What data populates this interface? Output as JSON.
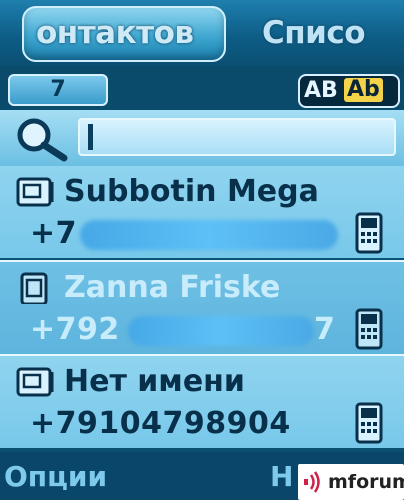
{
  "tabs": {
    "active": "онтактов",
    "other": "Списо"
  },
  "info": {
    "count": "7",
    "mode_ab": "AB",
    "mode_Ab": "Ab"
  },
  "search": {
    "value": ""
  },
  "contacts": [
    {
      "name": "Subbotin Mega",
      "number": "+7",
      "selected": false
    },
    {
      "name": "Zanna Friske",
      "number": "+792",
      "number_tail": "7",
      "selected": true
    },
    {
      "name": "Нет имени",
      "number": "+79104798904",
      "selected": false
    }
  ],
  "softkeys": {
    "left": "Опции",
    "right": "Н"
  },
  "watermark": {
    "text": "mforum.ru"
  },
  "colors": {
    "accent": "#6bbfe3",
    "selected": "#5db4dd",
    "text": "#08304a",
    "mode_highlight": "#f3d34a"
  }
}
